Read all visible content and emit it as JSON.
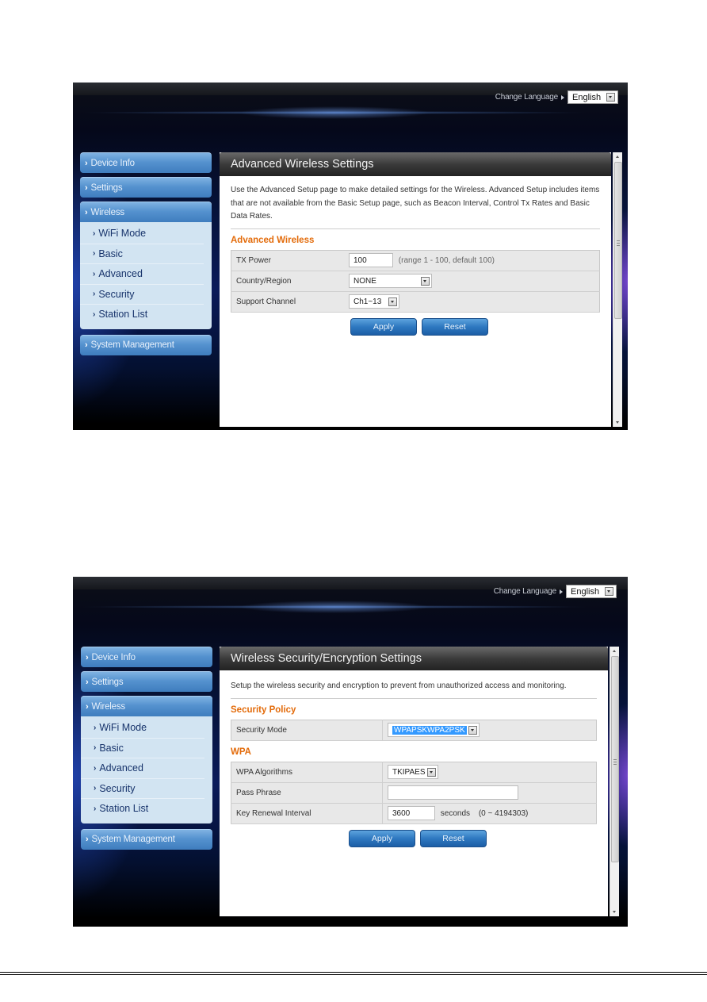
{
  "screens": [
    {
      "header": {
        "change_language_label": "Change Language",
        "language_value": "English"
      },
      "sidebar": {
        "top_items": [
          "Device Info",
          "Settings"
        ],
        "wireless_label": "Wireless",
        "wireless_sub": [
          "WiFi Mode",
          "Basic",
          "Advanced",
          "Security",
          "Station List"
        ],
        "bottom_items": [
          "System Management"
        ]
      },
      "content": {
        "title": "Advanced Wireless Settings",
        "description": "Use the Advanced Setup page to make detailed settings for the Wireless. Advanced Setup includes items that are not available from the Basic Setup page, such as Beacon Interval, Control Tx Rates and Basic Data Rates.",
        "section_title": "Advanced Wireless",
        "fields": {
          "tx_power": {
            "label": "TX Power",
            "value": "100",
            "hint": "(range 1 - 100, default 100)"
          },
          "country_region": {
            "label": "Country/Region",
            "value": "NONE"
          },
          "support_channel": {
            "label": "Support Channel",
            "value": "Ch1~13"
          }
        },
        "apply_label": "Apply",
        "reset_label": "Reset"
      }
    },
    {
      "header": {
        "change_language_label": "Change Language",
        "language_value": "English"
      },
      "sidebar": {
        "top_items": [
          "Device Info",
          "Settings"
        ],
        "wireless_label": "Wireless",
        "wireless_sub": [
          "WiFi Mode",
          "Basic",
          "Advanced",
          "Security",
          "Station List"
        ],
        "bottom_items": [
          "System Management"
        ]
      },
      "content": {
        "title": "Wireless Security/Encryption Settings",
        "description": "Setup the wireless security and encryption to prevent from unauthorized access and monitoring.",
        "policy_section_title": "Security Policy",
        "security_mode": {
          "label": "Security Mode",
          "value": "WPAPSKWPA2PSK"
        },
        "wpa_section_title": "WPA",
        "fields": {
          "wpa_algorithms": {
            "label": "WPA Algorithms",
            "value": "TKIPAES"
          },
          "pass_phrase": {
            "label": "Pass Phrase",
            "value": ""
          },
          "key_renewal": {
            "label": "Key Renewal Interval",
            "value": "3600",
            "unit": "seconds",
            "hint": "(0 ~ 4194303)"
          }
        },
        "apply_label": "Apply",
        "reset_label": "Reset"
      }
    }
  ]
}
